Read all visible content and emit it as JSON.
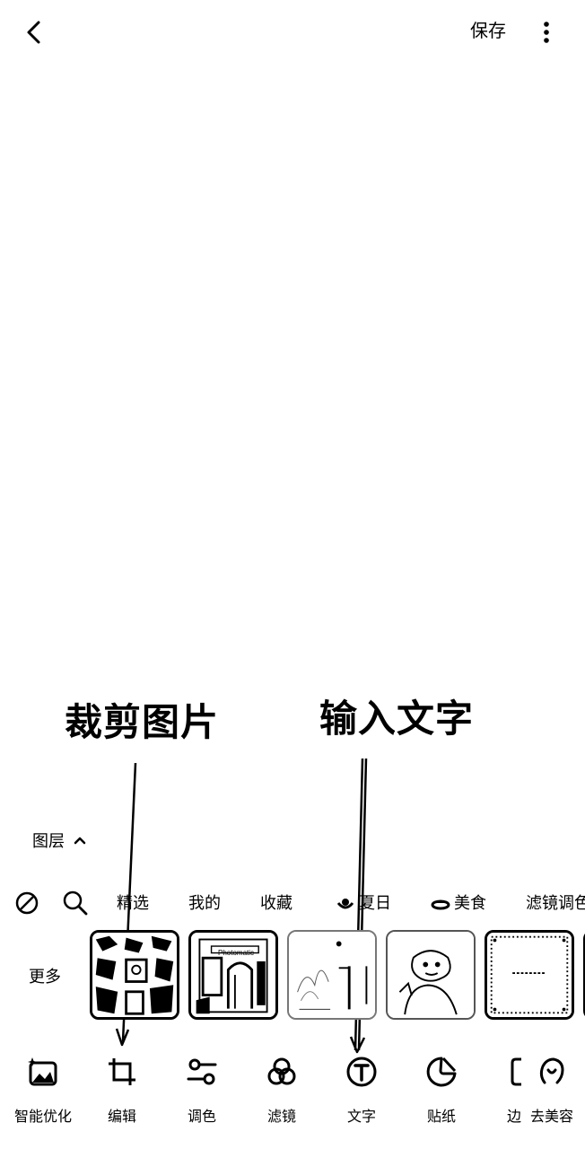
{
  "header": {
    "back_icon": "chevron-left-icon",
    "save_label": "保存",
    "more_icon": "vertical-dots-icon"
  },
  "annotations": {
    "crop_label": "裁剪图片",
    "text_label": "输入文字"
  },
  "layers": {
    "label": "图层",
    "toggle_icon": "chevron-up-icon"
  },
  "filter_tabs": {
    "icons": [
      "no-filter-icon",
      "search-icon"
    ],
    "items": [
      {
        "label": "精选"
      },
      {
        "label": "我的"
      },
      {
        "label": "收藏"
      },
      {
        "label": "夏日",
        "icon": "summer-icon"
      },
      {
        "label": "美食",
        "icon": "food-icon"
      },
      {
        "label": "滤镜调色"
      }
    ]
  },
  "thumbnails": {
    "more_label": "更多",
    "items": [
      {
        "name": "template-1"
      },
      {
        "name": "template-2",
        "caption": "Photomatic"
      },
      {
        "name": "template-3"
      },
      {
        "name": "template-4"
      },
      {
        "name": "template-5"
      }
    ]
  },
  "tools": [
    {
      "label": "智能优化",
      "icon": "auto-enhance-icon"
    },
    {
      "label": "编辑",
      "icon": "crop-icon"
    },
    {
      "label": "调色",
      "icon": "adjust-sliders-icon"
    },
    {
      "label": "滤镜",
      "icon": "filter-circles-icon"
    },
    {
      "label": "文字",
      "icon": "text-t-icon"
    },
    {
      "label": "贴纸",
      "icon": "sticker-icon"
    },
    {
      "label": "边",
      "icon": "border-icon"
    },
    {
      "label": "去美容",
      "icon": "beauty-icon"
    }
  ]
}
